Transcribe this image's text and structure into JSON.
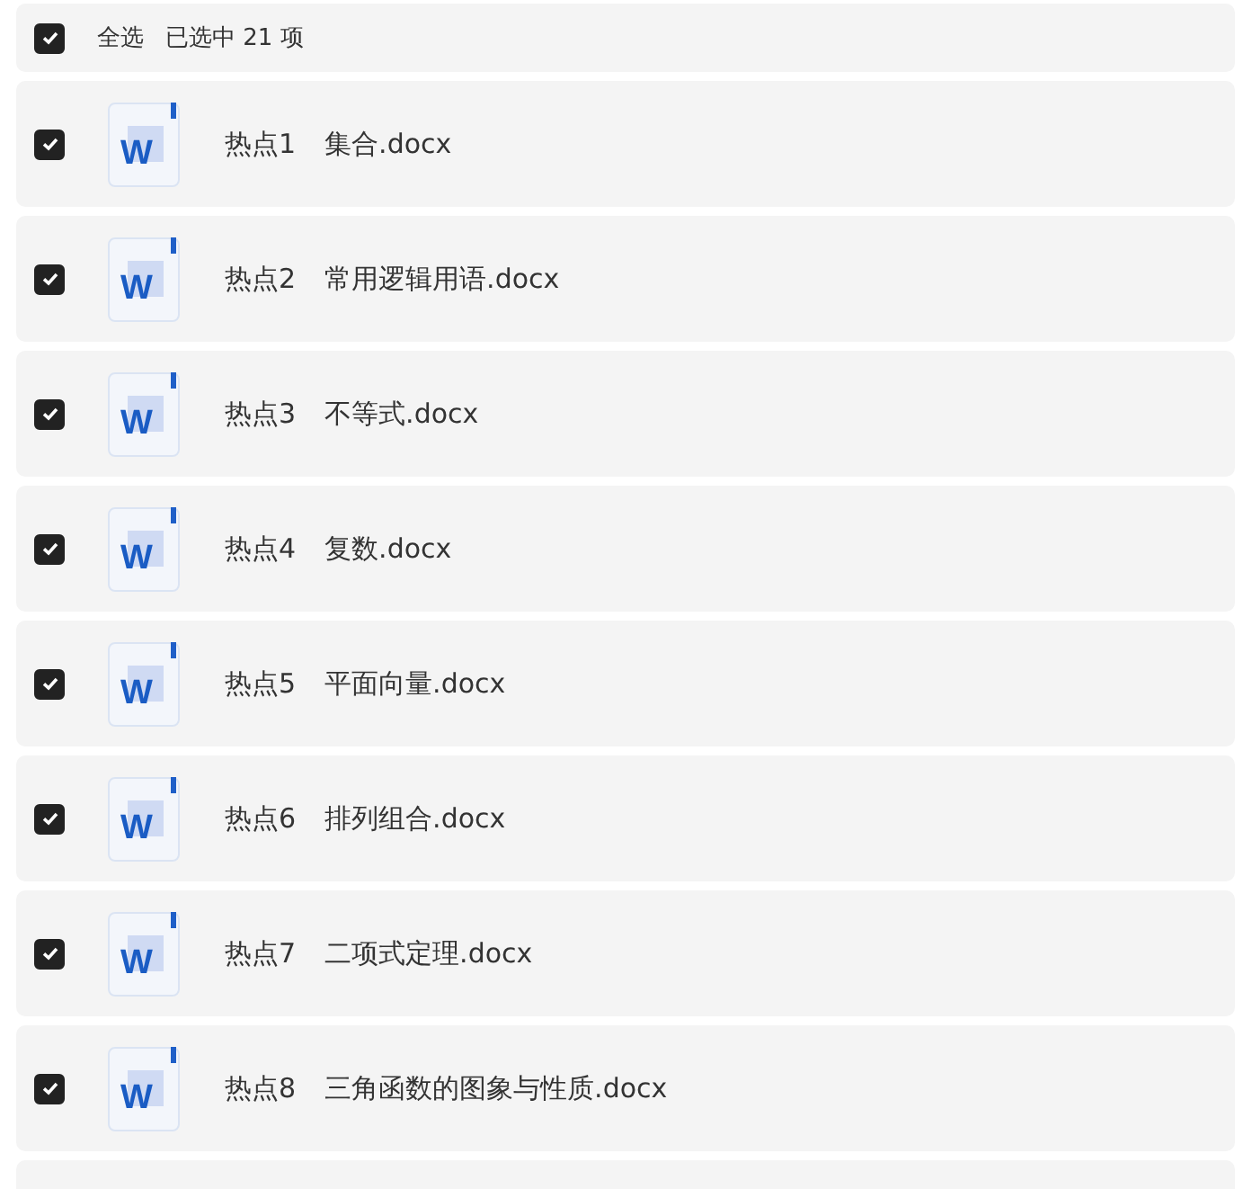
{
  "header": {
    "checked": true,
    "select_all_label": "全选",
    "selection_count": "已选中 21 项"
  },
  "files": [
    {
      "checked": true,
      "icon_letter": "W",
      "prefix": "热点1",
      "name": "集合.docx"
    },
    {
      "checked": true,
      "icon_letter": "W",
      "prefix": "热点2",
      "name": "常用逻辑用语.docx"
    },
    {
      "checked": true,
      "icon_letter": "W",
      "prefix": "热点3",
      "name": "不等式.docx"
    },
    {
      "checked": true,
      "icon_letter": "W",
      "prefix": "热点4",
      "name": "复数.docx"
    },
    {
      "checked": true,
      "icon_letter": "W",
      "prefix": "热点5",
      "name": "平面向量.docx"
    },
    {
      "checked": true,
      "icon_letter": "W",
      "prefix": "热点6",
      "name": "排列组合.docx"
    },
    {
      "checked": true,
      "icon_letter": "W",
      "prefix": "热点7",
      "name": "二项式定理.docx"
    },
    {
      "checked": true,
      "icon_letter": "W",
      "prefix": "热点8",
      "name": "三角函数的图象与性质.docx"
    }
  ]
}
